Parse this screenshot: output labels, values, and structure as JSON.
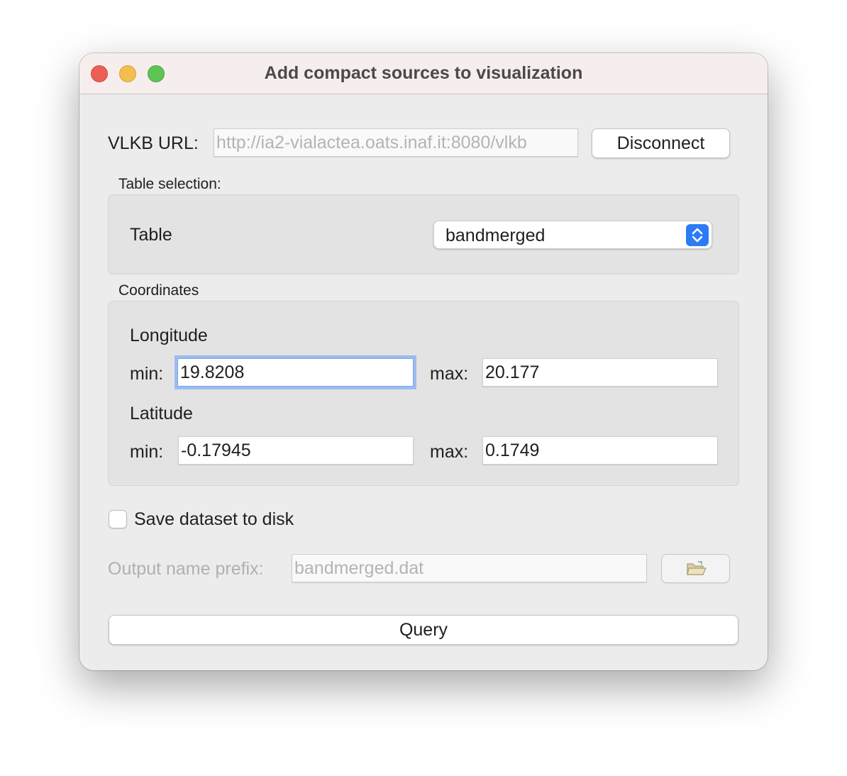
{
  "window": {
    "title": "Add compact sources to visualization"
  },
  "connection": {
    "url_label": "VLKB URL:",
    "url_value": "http://ia2-vialactea.oats.inaf.it:8080/vlkb",
    "disconnect_label": "Disconnect"
  },
  "table_selection": {
    "group_title": "Table selection:",
    "table_label": "Table",
    "selected_table": "bandmerged"
  },
  "coordinates": {
    "group_title": "Coordinates",
    "longitude": {
      "label": "Longitude",
      "min_label": "min:",
      "min_value": "19.8208",
      "max_label": "max:",
      "max_value": "20.177"
    },
    "latitude": {
      "label": "Latitude",
      "min_label": "min:",
      "min_value": "-0.17945",
      "max_label": "max:",
      "max_value": "0.1749"
    }
  },
  "save": {
    "checkbox_label": "Save dataset to disk",
    "checked": false,
    "prefix_label": "Output name prefix:",
    "prefix_value": "bandmerged.dat",
    "browse_icon": "folder-open-icon"
  },
  "actions": {
    "query_label": "Query"
  },
  "colors": {
    "close": "#ec5f57",
    "minimize": "#f3bd4f",
    "maximize": "#5fc454",
    "focus_ring": "#9cbcf0",
    "select_accent": "#2b7cf4"
  }
}
